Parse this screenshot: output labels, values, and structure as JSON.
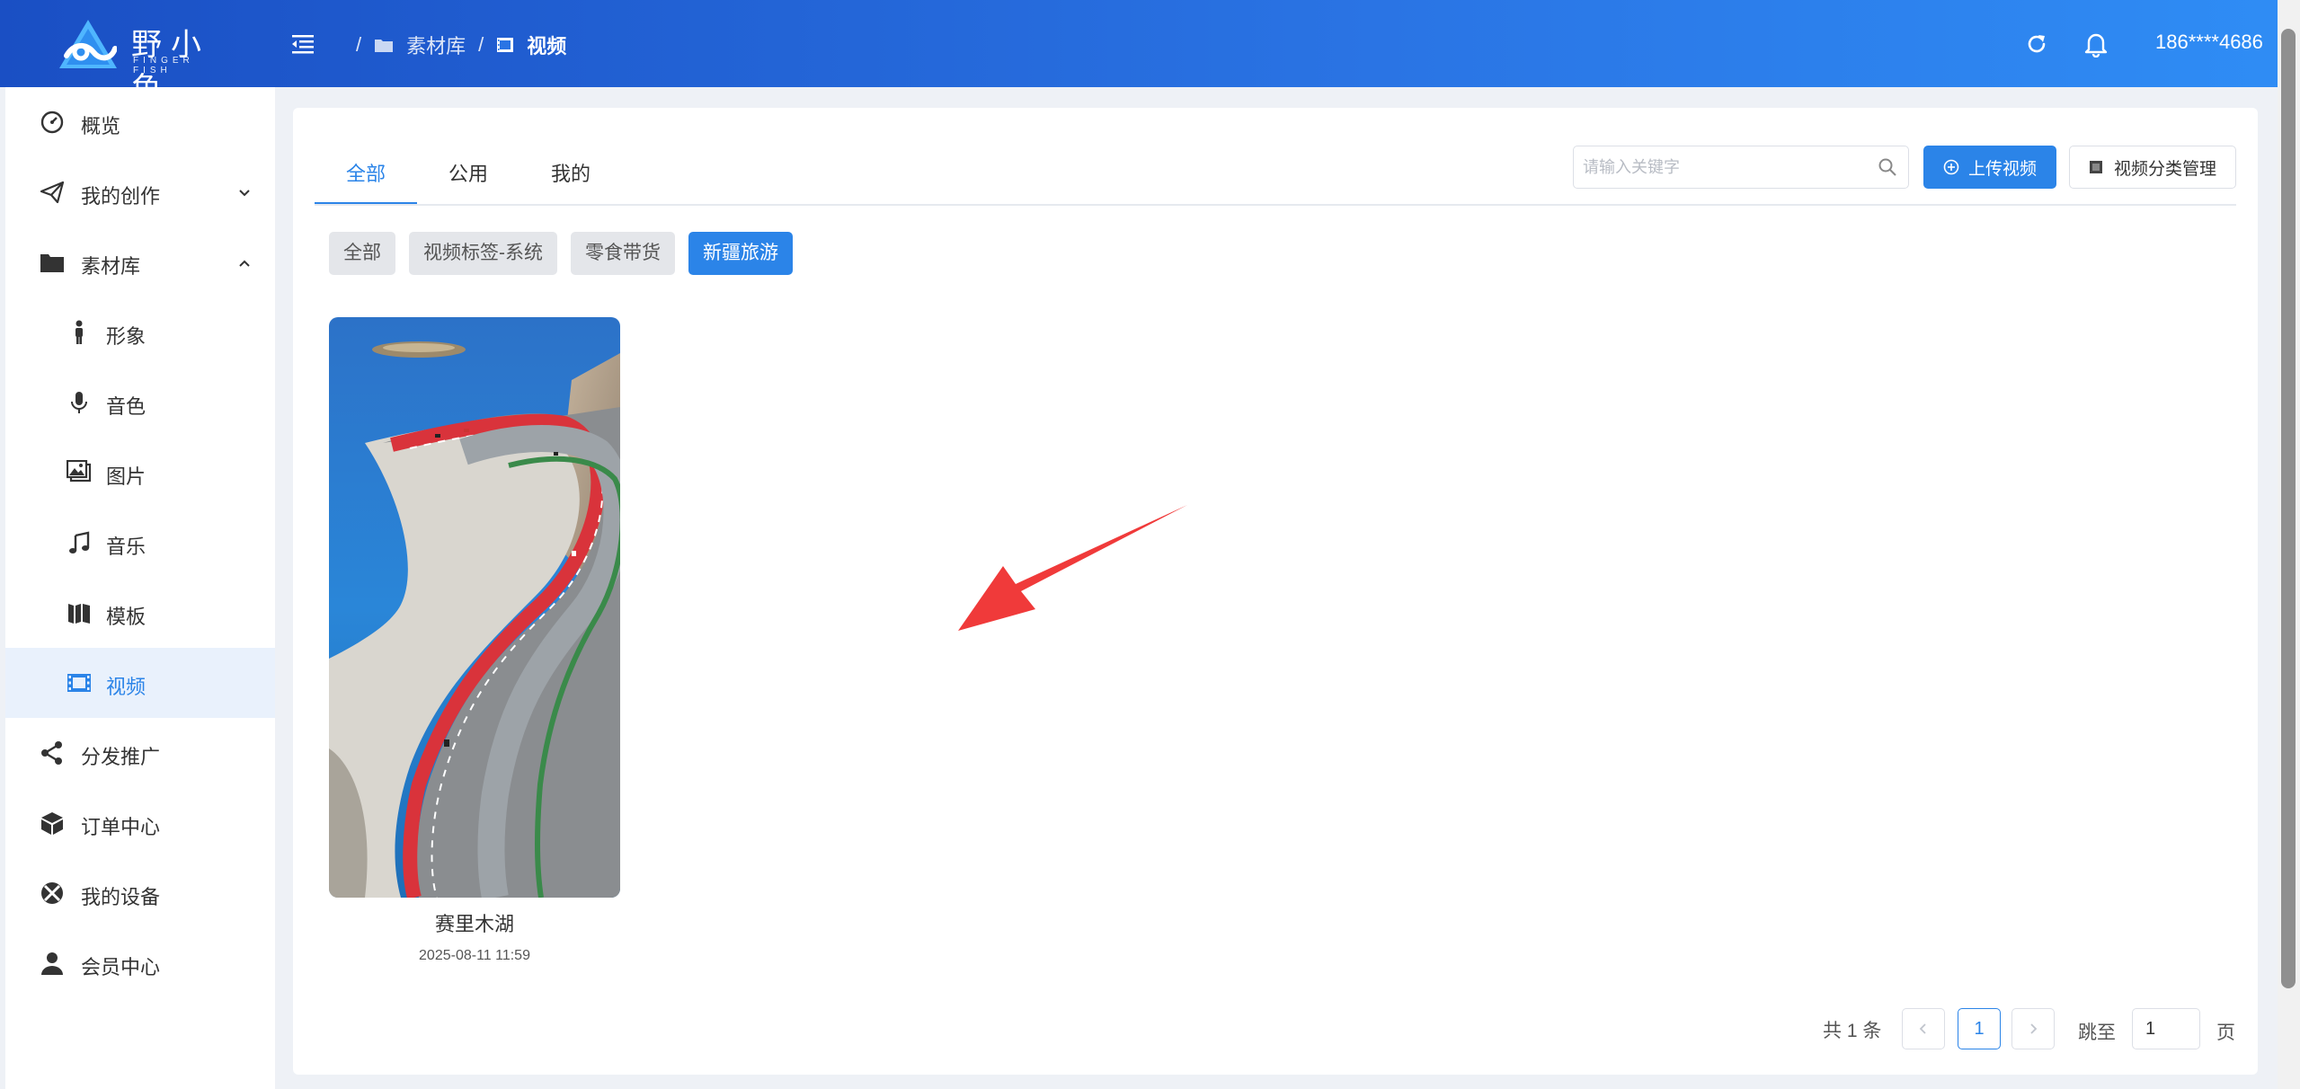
{
  "header": {
    "logo_cn": "野小鱼",
    "logo_en": "FINGER FISH",
    "breadcrumb": [
      {
        "label": "素材库",
        "icon": "folder-icon"
      },
      {
        "label": "视频",
        "icon": "film-icon"
      }
    ],
    "user_phone": "186****4686"
  },
  "sidebar": {
    "items": [
      {
        "label": "概览",
        "icon": "dashboard-icon"
      },
      {
        "label": "我的创作",
        "icon": "paper-plane-icon",
        "expanded": false
      },
      {
        "label": "素材库",
        "icon": "folder-icon",
        "expanded": true
      },
      {
        "label": "形象",
        "icon": "person-icon"
      },
      {
        "label": "音色",
        "icon": "microphone-icon"
      },
      {
        "label": "图片",
        "icon": "image-icon"
      },
      {
        "label": "音乐",
        "icon": "music-icon"
      },
      {
        "label": "模板",
        "icon": "template-icon"
      },
      {
        "label": "视频",
        "icon": "film-icon",
        "active": true
      },
      {
        "label": "分发推广",
        "icon": "share-icon"
      },
      {
        "label": "订单中心",
        "icon": "box-icon"
      },
      {
        "label": "我的设备",
        "icon": "device-icon"
      },
      {
        "label": "会员中心",
        "icon": "user-icon"
      }
    ]
  },
  "main": {
    "tabs": [
      {
        "label": "全部",
        "active": true
      },
      {
        "label": "公用"
      },
      {
        "label": "我的"
      }
    ],
    "search": {
      "placeholder": "请输入关键字",
      "value": ""
    },
    "upload_label": "上传视频",
    "category_label": "视频分类管理",
    "chips": [
      {
        "label": "全部"
      },
      {
        "label": "视频标签-系统"
      },
      {
        "label": "零食带货"
      },
      {
        "label": "新疆旅游",
        "active": true
      }
    ],
    "videos": [
      {
        "title": "赛里木湖",
        "date": "2025-08-11 11:59"
      }
    ]
  },
  "pagination": {
    "total_text": "共 1 条",
    "current_page": "1",
    "jump_label": "跳至",
    "jump_value": "1",
    "page_suffix": "页"
  },
  "colors": {
    "header_gradient_start": "#1a4fc4",
    "header_gradient_end": "#2f8df5",
    "accent": "#2b84e8",
    "active_bg": "#e9f1fc",
    "annotation_arrow": "#f03a3a"
  }
}
